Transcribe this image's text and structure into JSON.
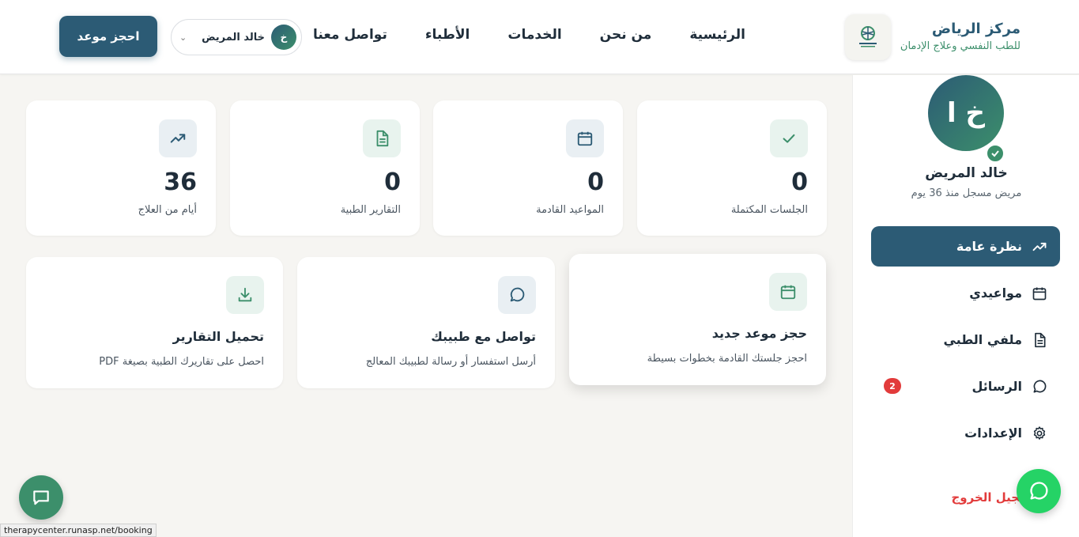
{
  "brand": {
    "name": "مركز الرياض",
    "subtitle": "للطب النفسي وعلاج الإدمان"
  },
  "nav": {
    "items": [
      {
        "label": "الرئيسية"
      },
      {
        "label": "من نحن"
      },
      {
        "label": "الخدمات"
      },
      {
        "label": "الأطباء"
      },
      {
        "label": "تواصل معنا"
      }
    ]
  },
  "user": {
    "initial": "خ",
    "name": "خالد المريض",
    "initials": "خ ا",
    "since": "مريض مسجل منذ 36 يوم"
  },
  "header": {
    "book_label": "احجز موعد"
  },
  "sidebar": {
    "items": [
      {
        "label": "نظرة عامة",
        "icon": "trending-up-icon",
        "active": true
      },
      {
        "label": "مواعيدي",
        "icon": "calendar-icon"
      },
      {
        "label": "ملفي الطبي",
        "icon": "document-icon"
      },
      {
        "label": "الرسائل",
        "icon": "chat-icon",
        "badge": "2"
      },
      {
        "label": "الإعدادات",
        "icon": "gear-icon"
      }
    ],
    "logout_label": "تسجيل الخروج"
  },
  "stats": [
    {
      "value": "0",
      "label": "الجلسات المكتملة",
      "icon": "check-icon"
    },
    {
      "value": "0",
      "label": "المواعيد القادمة",
      "icon": "calendar-icon"
    },
    {
      "value": "0",
      "label": "التقارير الطبية",
      "icon": "document-icon"
    },
    {
      "value": "36",
      "label": "أيام من العلاج",
      "icon": "trending-up-icon"
    }
  ],
  "actions": [
    {
      "title": "حجز موعد جديد",
      "desc": "احجز جلستك القادمة بخطوات بسيطة",
      "icon": "calendar-icon"
    },
    {
      "title": "تواصل مع طبيبك",
      "desc": "أرسل استفسار أو رسالة لطبيبك المعالج",
      "icon": "chat-icon"
    },
    {
      "title": "تحميل التقارير",
      "desc": "احصل على تقاريرك الطبية بصيغة PDF",
      "icon": "download-icon"
    }
  ],
  "status_bar": {
    "url": "therapycenter.runasp.net/booking"
  },
  "colors": {
    "primary": "#2c5b75",
    "accent": "#3c8f6b",
    "danger": "#e23b3b",
    "whatsapp": "#25d366"
  }
}
